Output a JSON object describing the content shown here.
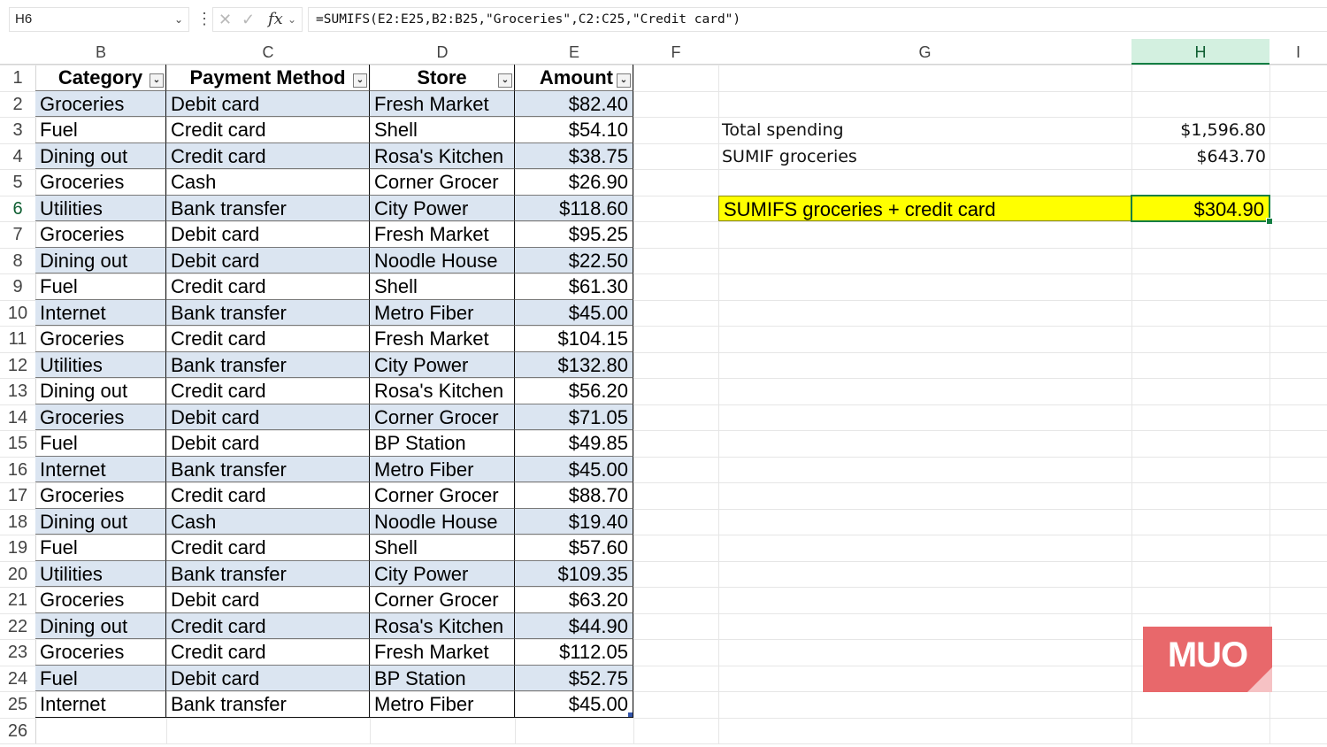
{
  "name_box": "H6",
  "formula": "=SUMIFS(E2:E25,B2:B25,\"Groceries\",C2:C25,\"Credit card\")",
  "fx_label": "fx",
  "columns": [
    "B",
    "C",
    "D",
    "E",
    "F",
    "G",
    "H",
    "I"
  ],
  "headers": [
    "Category",
    "Payment Method",
    "Store",
    "Amount"
  ],
  "rows": [
    [
      "Groceries",
      "Debit card",
      "Fresh Market",
      "$82.40"
    ],
    [
      "Fuel",
      "Credit card",
      "Shell",
      "$54.10"
    ],
    [
      "Dining out",
      "Credit card",
      "Rosa's Kitchen",
      "$38.75"
    ],
    [
      "Groceries",
      "Cash",
      "Corner Grocer",
      "$26.90"
    ],
    [
      "Utilities",
      "Bank transfer",
      "City Power",
      "$118.60"
    ],
    [
      "Groceries",
      "Debit card",
      "Fresh Market",
      "$95.25"
    ],
    [
      "Dining out",
      "Debit card",
      "Noodle House",
      "$22.50"
    ],
    [
      "Fuel",
      "Credit card",
      "Shell",
      "$61.30"
    ],
    [
      "Internet",
      "Bank transfer",
      "Metro Fiber",
      "$45.00"
    ],
    [
      "Groceries",
      "Credit card",
      "Fresh Market",
      "$104.15"
    ],
    [
      "Utilities",
      "Bank transfer",
      "City Power",
      "$132.80"
    ],
    [
      "Dining out",
      "Credit card",
      "Rosa's Kitchen",
      "$56.20"
    ],
    [
      "Groceries",
      "Debit card",
      "Corner Grocer",
      "$71.05"
    ],
    [
      "Fuel",
      "Debit card",
      "BP Station",
      "$49.85"
    ],
    [
      "Internet",
      "Bank transfer",
      "Metro Fiber",
      "$45.00"
    ],
    [
      "Groceries",
      "Credit card",
      "Corner Grocer",
      "$88.70"
    ],
    [
      "Dining out",
      "Cash",
      "Noodle House",
      "$19.40"
    ],
    [
      "Fuel",
      "Credit card",
      "Shell",
      "$57.60"
    ],
    [
      "Utilities",
      "Bank transfer",
      "City Power",
      "$109.35"
    ],
    [
      "Groceries",
      "Debit card",
      "Corner Grocer",
      "$63.20"
    ],
    [
      "Dining out",
      "Credit card",
      "Rosa's Kitchen",
      "$44.90"
    ],
    [
      "Groceries",
      "Credit card",
      "Fresh Market",
      "$112.05"
    ],
    [
      "Fuel",
      "Debit card",
      "BP Station",
      "$52.75"
    ],
    [
      "Internet",
      "Bank transfer",
      "Metro Fiber",
      "$45.00"
    ]
  ],
  "summary": [
    {
      "label": "Total spending",
      "value": "$1,596.80"
    },
    {
      "label": "SUMIF groceries",
      "value": "$643.70"
    }
  ],
  "highlight": {
    "label": "SUMIFS groceries + credit card",
    "value": "$304.90"
  },
  "watermark": "MUO",
  "colors": {
    "band": "#dbe5f1",
    "highlight": "#ffff00",
    "selection": "#137e43",
    "logo": "#e8686b"
  }
}
